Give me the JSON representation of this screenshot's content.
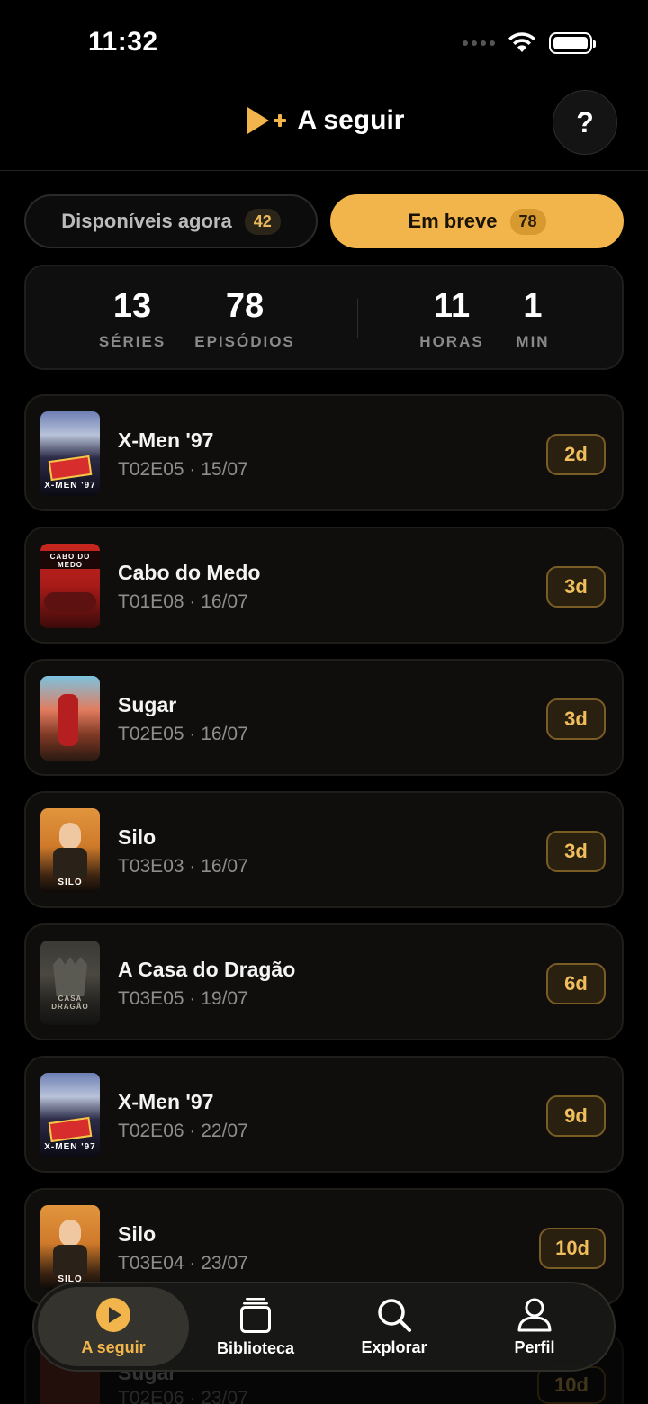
{
  "status_bar": {
    "time": "11:32"
  },
  "header": {
    "title": "A seguir",
    "help_label": "?"
  },
  "segments": {
    "available": {
      "label": "Disponíveis agora",
      "count": "42"
    },
    "upcoming": {
      "label": "Em breve",
      "count": "78"
    }
  },
  "stats": [
    {
      "value": "13",
      "label": "SÉRIES"
    },
    {
      "value": "78",
      "label": "EPISÓDIOS"
    },
    {
      "value": "11",
      "label": "HORAS"
    },
    {
      "value": "1",
      "label": "MIN"
    }
  ],
  "episodes": [
    {
      "title": "X-Men '97",
      "subtitle": "T02E05 · 15/07",
      "badge": "2d",
      "poster_text": "X-MEN '97"
    },
    {
      "title": "Cabo do Medo",
      "subtitle": "T01E08 · 16/07",
      "badge": "3d",
      "poster_text": "CABO DO MEDO"
    },
    {
      "title": "Sugar",
      "subtitle": "T02E05 · 16/07",
      "badge": "3d",
      "poster_text": ""
    },
    {
      "title": "Silo",
      "subtitle": "T03E03 · 16/07",
      "badge": "3d",
      "poster_text": "SILO"
    },
    {
      "title": "A Casa do Dragão",
      "subtitle": "T03E05 · 19/07",
      "badge": "6d",
      "poster_text": "CASA DRAGÃO"
    },
    {
      "title": "X-Men '97",
      "subtitle": "T02E06 · 22/07",
      "badge": "9d",
      "poster_text": "X-MEN '97"
    },
    {
      "title": "Silo",
      "subtitle": "T03E04 · 23/07",
      "badge": "10d",
      "poster_text": "SILO"
    }
  ],
  "partial_episode": {
    "title": "Sugar",
    "subtitle": "T02E06 · 23/07",
    "badge": "10d"
  },
  "tabbar": [
    {
      "label": "A seguir",
      "icon": "play-circle-icon",
      "active": true
    },
    {
      "label": "Biblioteca",
      "icon": "library-icon",
      "active": false
    },
    {
      "label": "Explorar",
      "icon": "search-icon",
      "active": false
    },
    {
      "label": "Perfil",
      "icon": "profile-icon",
      "active": false
    }
  ],
  "colors": {
    "accent": "#f2b54b",
    "background": "#000000",
    "card": "#0f0e0c"
  }
}
